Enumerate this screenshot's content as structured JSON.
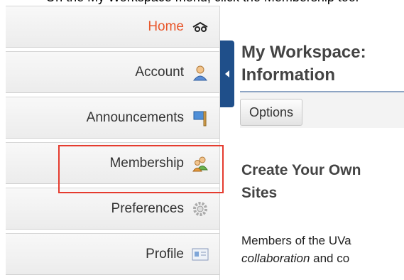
{
  "caption": "On the My Workspace menu, click the Membership tool",
  "sidebar": {
    "items": [
      {
        "label": "Home",
        "icon": "home-icon",
        "active": true
      },
      {
        "label": "Account",
        "icon": "account-person-icon"
      },
      {
        "label": "Announcements",
        "icon": "announcements-flag-icon"
      },
      {
        "label": "Membership",
        "icon": "membership-people-icon",
        "highlighted": true
      },
      {
        "label": "Preferences",
        "icon": "preferences-gear-icon"
      },
      {
        "label": "Profile",
        "icon": "profile-card-icon"
      }
    ]
  },
  "main": {
    "title_line1": "My Workspace:",
    "title_line2": "Information",
    "options_label": "Options",
    "section_heading_line1": "Create Your Own",
    "section_heading_line2": "Sites",
    "body_line1": "Members of the UVa",
    "body_italic1": "collaboration",
    "body_line2_mid": " and co"
  },
  "colors": {
    "active_nav": "#e8572c",
    "highlight_border": "#e53b2e",
    "collapse_tab": "#1f4f8a"
  }
}
